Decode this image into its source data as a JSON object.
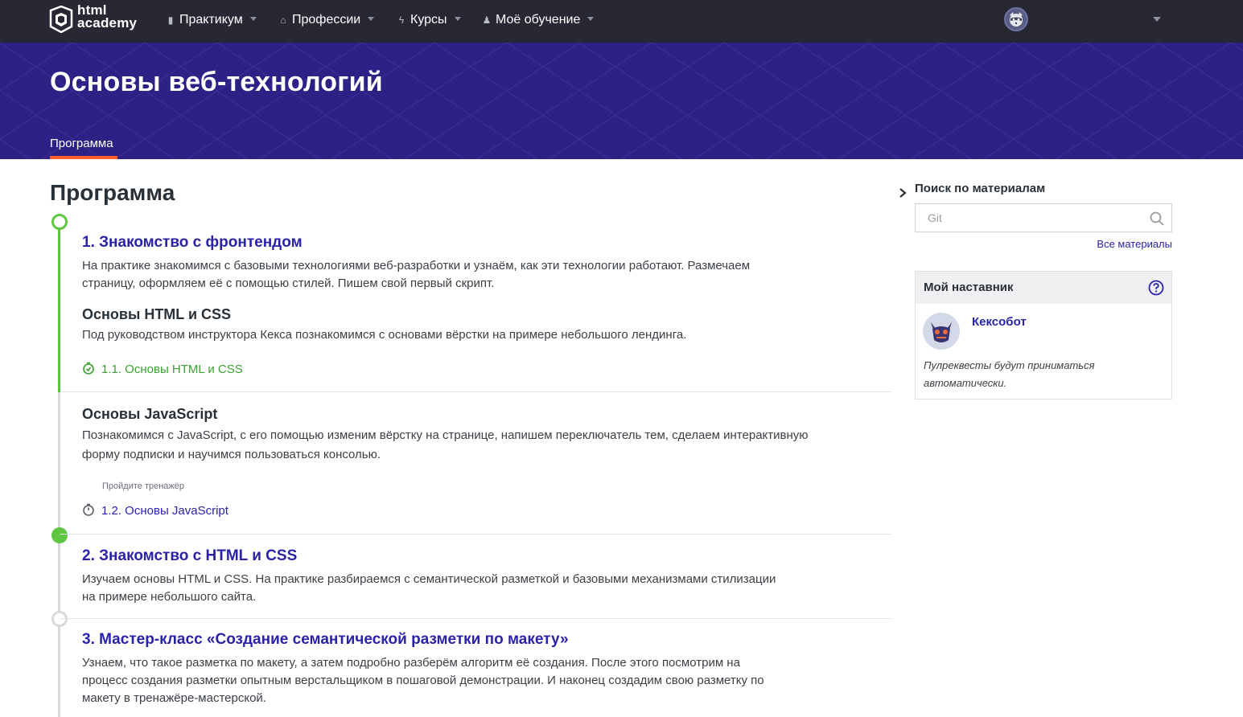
{
  "colors": {
    "nav_bg": "#272833",
    "banner_bg": "#2c2184",
    "accent_link": "#2a23a7",
    "done_green": "#5ec641",
    "tab_underline": "#ff5d2c"
  },
  "header": {
    "logo_line1": "html",
    "logo_line2": "academy",
    "nav": [
      {
        "label": "Практикум",
        "icon": "chart-icon"
      },
      {
        "label": "Профессии",
        "icon": "graduation-cap-icon"
      },
      {
        "label": "Курсы",
        "icon": "lightning-icon"
      },
      {
        "label": "Моё обучение",
        "icon": "people-icon"
      }
    ],
    "avatar_icon": "raccoon-avatar-icon"
  },
  "banner": {
    "title": "Основы веб-технологий",
    "tab": "Программа"
  },
  "main": {
    "title": "Программа",
    "sections": [
      {
        "title": "1. Знакомство с фронтендом",
        "desc_line1": "На практике знакомимся с базовыми технологиями веб-разработки и узнаём, как эти технологии работают. Размечаем",
        "desc_line2": "страницу, оформляем её с помощью стилей. Пишем свой первый скрипт.",
        "status": "in-progress",
        "modules": [
          {
            "title": "Основы HTML и CSS",
            "desc_line1": "Под руководством инструктора Кекса познакомимся с основами вёрстки на примере небольшого лендинга.",
            "lesson": "1.1. Основы HTML и CSS",
            "lesson_status": "done"
          },
          {
            "title": "Основы JavaScript",
            "desc_line1": "Познакомимся с JavaScript, с его помощью изменим вёрстку на странице, напишем переключатель тем, сделаем интерактивную",
            "desc_line2": "форму подписки и научимся пользоваться консолью.",
            "hint": "Пройдите тренажёр",
            "lesson": "1.2. Основы JavaScript",
            "lesson_status": "todo"
          }
        ]
      },
      {
        "title": "2. Знакомство с HTML и CSS",
        "desc_line1": "Изучаем основы HTML и CSS. На практике разбираемся с семантической разметкой и базовыми механизмами стилизации",
        "desc_line2": "на примере небольшого сайта.",
        "status": "done"
      },
      {
        "title": "3. Мастер-класс «Создание семантической разметки по макету»",
        "desc_line1": "Узнаем, что такое разметка по макету, а затем подробно разберём алгоритм её создания. После этого посмотрим на",
        "desc_line2": "процесс создания разметки опытным верстальщиком в пошаговой демонстрации. И наконец создадим свою разметку по",
        "desc_line3": "макету в тренажёре-мастерской.",
        "status": "not-started"
      }
    ]
  },
  "sidebar": {
    "search_label": "Поиск по материалам",
    "search_placeholder": "Git",
    "all_materials": "Все материалы",
    "mentor_title": "Мой наставник",
    "mentor_name": "Кексобот",
    "mentor_note_line1": "Пулреквесты будут приниматься",
    "mentor_note_line2": "автоматически."
  }
}
